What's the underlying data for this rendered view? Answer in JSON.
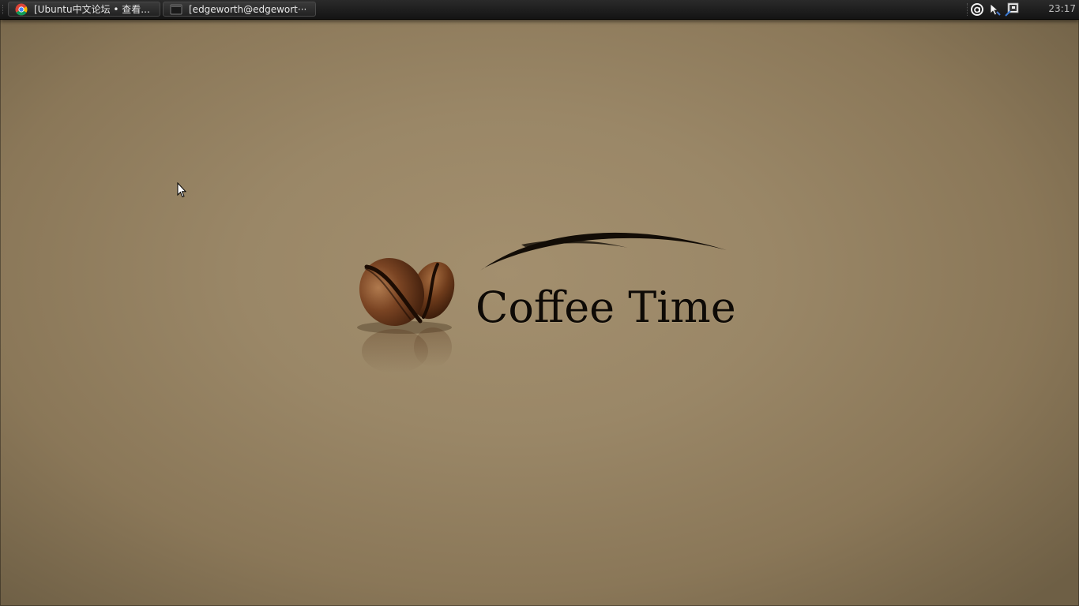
{
  "panel": {
    "tasks": [
      {
        "label": "[Ubuntu中文论坛 • 查看...",
        "icon": "chrome-icon"
      },
      {
        "label": "[edgeworth@edgewort···",
        "icon": "terminal-icon"
      }
    ],
    "tray_icons": [
      "account-icon",
      "pointer-tool-icon",
      "screenshot-icon"
    ],
    "clock": "23:17"
  },
  "wallpaper": {
    "title": "Coffee Time",
    "colors": {
      "background": "#9a8767",
      "text": "#0e0a06",
      "bean": "#6b3a1c"
    }
  }
}
